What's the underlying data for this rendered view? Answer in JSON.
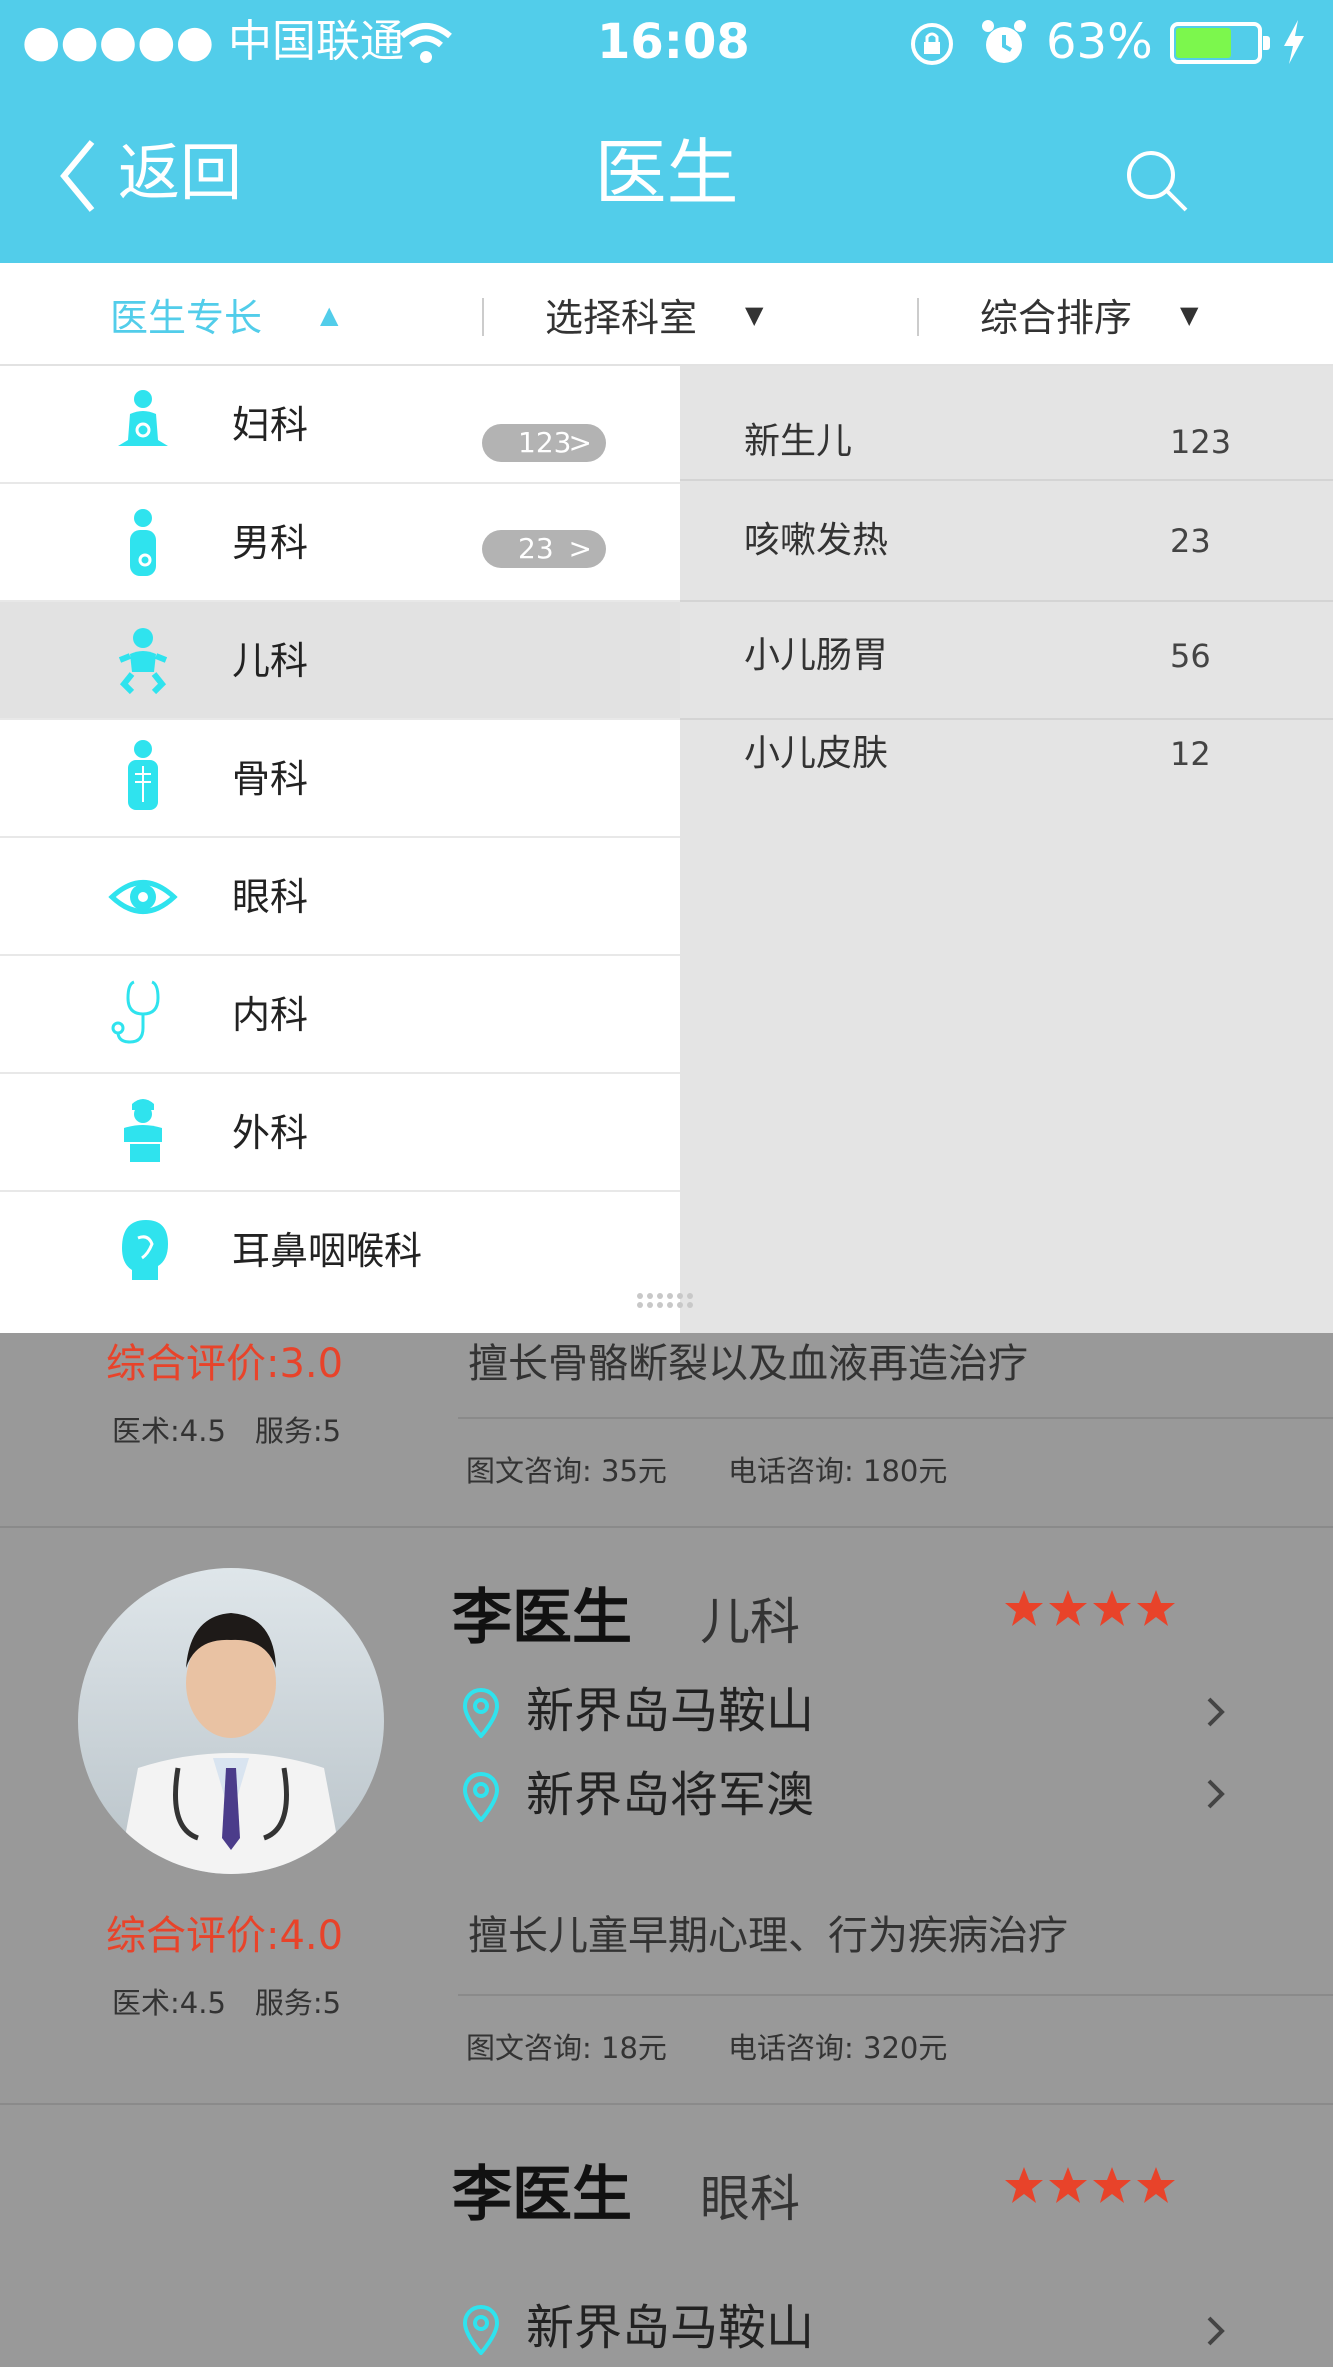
{
  "status_bar": {
    "carrier": "●●●●● 中国联通",
    "time": "16:08",
    "battery": "63%"
  },
  "nav": {
    "back_label": "返回",
    "title": "医生"
  },
  "filters": [
    {
      "label": "医生专长",
      "arrow": "▲"
    },
    {
      "label": "选择科室",
      "arrow": "▼"
    },
    {
      "label": "综合排序",
      "arrow": "▼"
    }
  ],
  "specialties": [
    {
      "label": "妇科",
      "icon": "female-patient-icon",
      "badge": "123"
    },
    {
      "label": "男科",
      "icon": "male-patient-icon",
      "badge": "23"
    },
    {
      "label": "儿科",
      "icon": "child-icon"
    },
    {
      "label": "骨科",
      "icon": "skeleton-person-icon"
    },
    {
      "label": "眼科",
      "icon": "eye-icon"
    },
    {
      "label": "内科",
      "icon": "stethoscope-icon"
    },
    {
      "label": "外科",
      "icon": "surgeon-icon"
    },
    {
      "label": "耳鼻咽喉科",
      "icon": "head-ent-icon"
    }
  ],
  "subcategories": [
    {
      "label": "新生儿",
      "count": "123"
    },
    {
      "label": "咳嗽发热",
      "count": "23"
    },
    {
      "label": "小儿肠胃",
      "count": "56"
    },
    {
      "label": "小儿皮肤",
      "count": "12"
    }
  ],
  "doctors": [
    {
      "rating_label": "综合评价:3.0",
      "sub_scores": "医术:4.5　服务:5",
      "specialty_desc": "擅长骨骼断裂以及血液再造治疗",
      "text_consult": "图文咨询: 35元",
      "phone_consult": "电话咨询: 180元"
    },
    {
      "name": "李医生",
      "department": "儿科",
      "stars": 4,
      "locations": [
        "新界岛马鞍山",
        "新界岛将军澳"
      ],
      "rating_label": "综合评价:4.0",
      "sub_scores": "医术:4.5　服务:5",
      "specialty_desc": "擅长儿童早期心理、行为疾病治疗",
      "text_consult": "图文咨询: 18元",
      "phone_consult": "电话咨询: 320元"
    },
    {
      "name": "李医生",
      "department": "眼科",
      "stars": 4,
      "locations": [
        "新界岛马鞍山"
      ]
    }
  ],
  "colors": {
    "accent": "#52cdea",
    "icon": "#2fe3ee",
    "rating_red": "#e8432a",
    "overlay": "#999999"
  }
}
